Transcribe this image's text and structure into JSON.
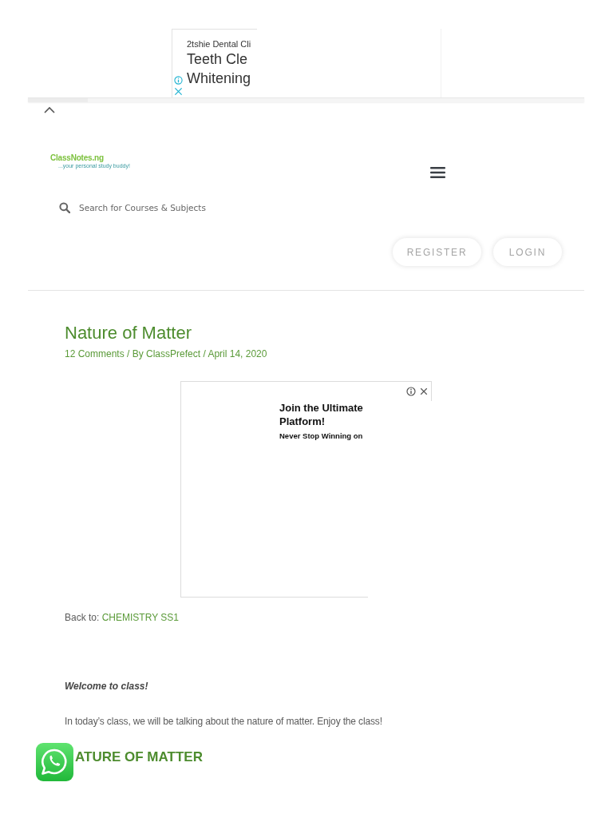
{
  "top_ad": {
    "advertiser": "2tshie Dental Cli",
    "headline": [
      "Teeth Cle",
      "Whitening"
    ]
  },
  "header": {
    "logo": {
      "name": "ClassNotes.ng",
      "tagline": "...your personal study buddy!"
    },
    "search": {
      "placeholder": "Search for Courses & Subjects"
    },
    "buttons": [
      {
        "label": "REGISTER"
      },
      {
        "label": "LOGIN"
      }
    ]
  },
  "article": {
    "title": "Nature of Matter",
    "meta": "12 Comments / By ClassPrefect / April 14, 2020",
    "ad": {
      "headline": [
        "Join the Ultimate",
        "Platform!"
      ],
      "subline": "Never Stop Winning on"
    },
    "back_link": {
      "label": "Back to:",
      "link": "CHEMISTRY SS1"
    },
    "body": [
      {
        "kind": "emphasis",
        "text": "Welcome to class!"
      },
      {
        "kind": "paragraph",
        "text": "In today’s class, we will be talking about the nature of matter. Enjoy the class!"
      },
      {
        "kind": "heading",
        "text": "ATURE OF MATTER"
      }
    ]
  }
}
